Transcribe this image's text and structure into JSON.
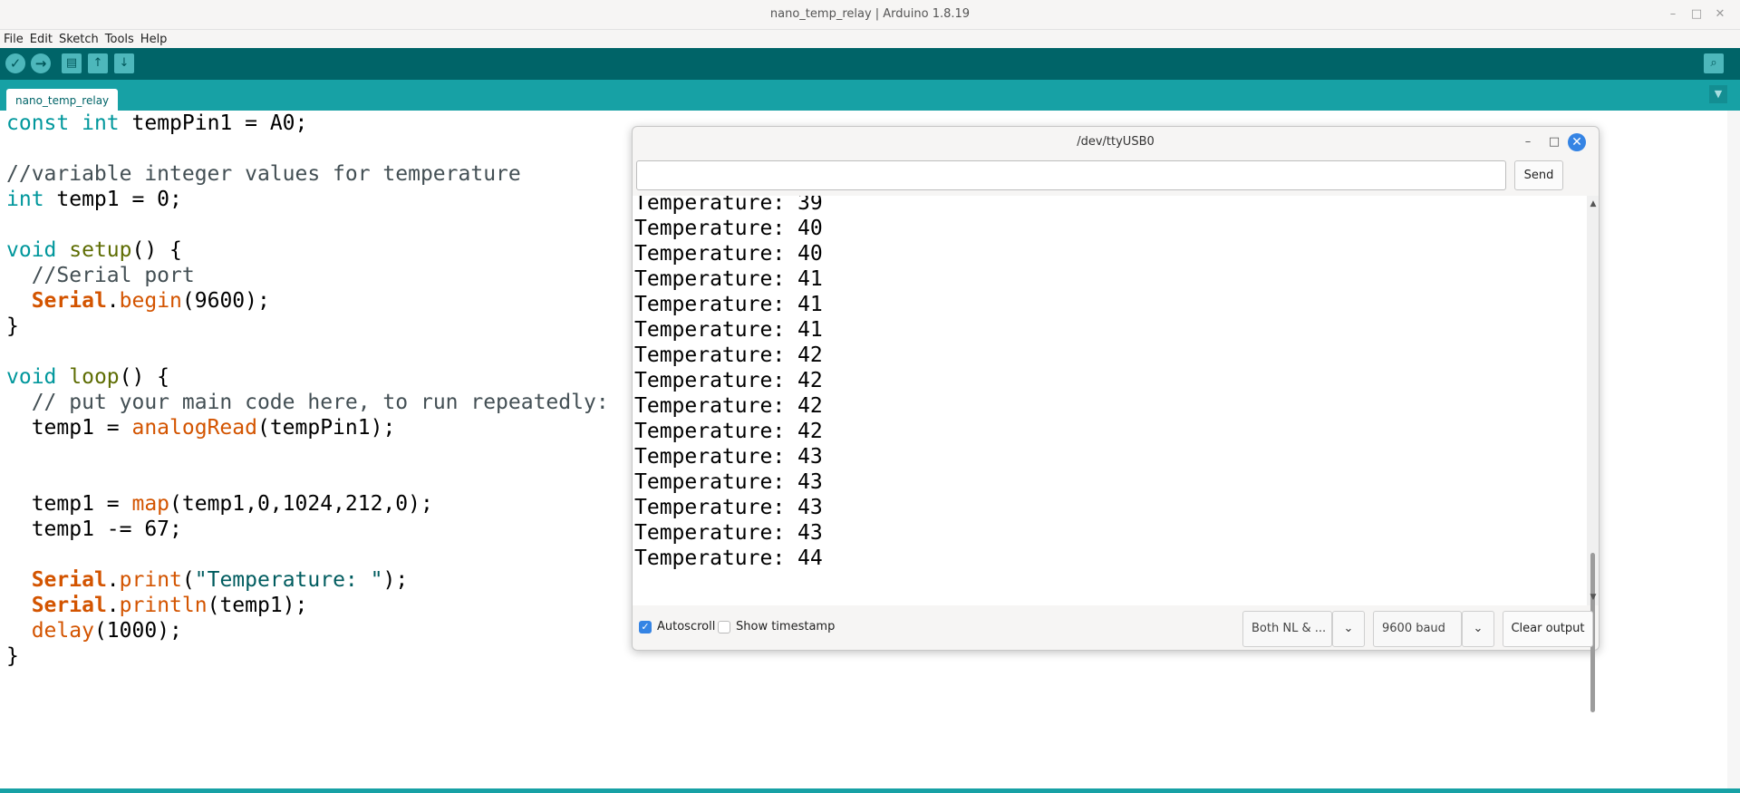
{
  "window": {
    "title": "nano_temp_relay | Arduino 1.8.19"
  },
  "menu": {
    "items": [
      "File",
      "Edit",
      "Sketch",
      "Tools",
      "Help"
    ]
  },
  "tabs": [
    {
      "label": "nano_temp_relay"
    }
  ],
  "editor": {
    "lines": [
      "const int tempPin1 = A0;",
      "",
      "//variable integer values for temperature",
      "int temp1 = 0;",
      "",
      "void setup() {",
      "  //Serial port",
      "  Serial.begin(9600);",
      "}",
      "",
      "void loop() {",
      "  // put your main code here, to run repeatedly:",
      "  temp1 = analogRead(tempPin1);",
      "",
      "",
      "  temp1 = map(temp1,0,1024,212,0);",
      "  temp1 -= 67;",
      "",
      "  Serial.print(\"Temperature: \");",
      "  Serial.println(temp1);",
      "  delay(1000);",
      "}"
    ]
  },
  "serial_monitor": {
    "title": "/dev/ttyUSB0",
    "input_value": "",
    "send_label": "Send",
    "output": [
      "Temperature: 39",
      "Temperature: 40",
      "Temperature: 40",
      "Temperature: 41",
      "Temperature: 41",
      "Temperature: 41",
      "Temperature: 42",
      "Temperature: 42",
      "Temperature: 42",
      "Temperature: 42",
      "Temperature: 43",
      "Temperature: 43",
      "Temperature: 43",
      "Temperature: 43",
      "Temperature: 44"
    ],
    "autoscroll_label": "Autoscroll",
    "autoscroll_checked": true,
    "timestamp_label": "Show timestamp",
    "timestamp_checked": false,
    "line_ending": "Both NL & ...",
    "baud": "9600 baud",
    "clear_label": "Clear output"
  },
  "colors": {
    "toolbar": "#006468",
    "tabbar": "#17a1a5",
    "keyword": "#00979c",
    "function": "#5e6d03",
    "object": "#d35400",
    "string": "#005c5f",
    "accent": "#3584e4"
  },
  "icons": {
    "verify": "verify-icon",
    "upload": "upload-icon",
    "new": "new-icon",
    "open": "open-icon",
    "save": "save-icon",
    "serial_monitor": "serial-monitor-icon"
  }
}
